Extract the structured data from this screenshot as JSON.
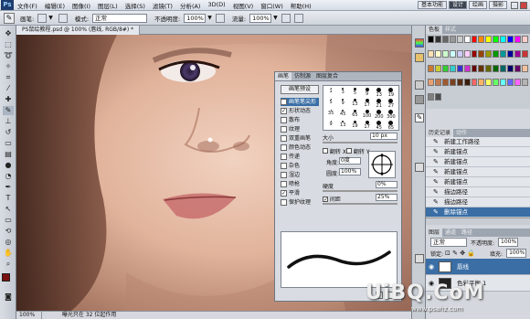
{
  "menubar": {
    "logo": "Ps",
    "items": [
      "文件(F)",
      "编辑(E)",
      "图像(I)",
      "图层(L)",
      "选择(S)",
      "滤镜(T)",
      "分析(A)",
      "3D(D)",
      "视图(V)",
      "窗口(W)",
      "帮助(H)"
    ],
    "workspace_buttons": [
      "基本功能",
      "设计",
      "绘画",
      "摄影"
    ],
    "active_workspace": "设计"
  },
  "options": {
    "mode_label": "模式:",
    "mode_value": "正常",
    "opacity_label": "不透明度:",
    "opacity_value": "100%",
    "flow_label": "流量:",
    "flow_value": "100%"
  },
  "document": {
    "tab_title": "PS鼠绘教程.psd @ 100% (唇线, RGB/8#) *",
    "zoom": "100%",
    "status": "曝光只在 32 位起作用"
  },
  "brush_panel": {
    "tabs": [
      "画笔",
      "仿制源",
      "图层复合"
    ],
    "active_tab": "画笔",
    "preset_button": "画笔预设",
    "options": [
      {
        "label": "画笔笔尖形状",
        "checked": false,
        "selected": true
      },
      {
        "label": "形状动态",
        "checked": true,
        "selected": false
      },
      {
        "label": "散布",
        "checked": false,
        "selected": false
      },
      {
        "label": "纹理",
        "checked": false,
        "selected": false
      },
      {
        "label": "双重画笔",
        "checked": false,
        "selected": false
      },
      {
        "label": "颜色动态",
        "checked": false,
        "selected": false
      },
      {
        "label": "传递",
        "checked": false,
        "selected": false
      },
      {
        "label": "杂色",
        "checked": false,
        "selected": false
      },
      {
        "label": "湿边",
        "checked": false,
        "selected": false
      },
      {
        "label": "喷枪",
        "checked": false,
        "selected": false
      },
      {
        "label": "平滑",
        "checked": true,
        "selected": false
      },
      {
        "label": "保护纹理",
        "checked": false,
        "selected": false
      }
    ],
    "tips": [
      "1",
      "3",
      "5",
      "9",
      "13",
      "19",
      "5",
      "9",
      "13",
      "17",
      "21",
      "27",
      "35",
      "45",
      "65",
      "100",
      "200",
      "300",
      "9",
      "13",
      "19",
      "17",
      "45",
      "65"
    ],
    "size_label": "大小",
    "size_value": "10 px",
    "flipx_label": "翻转 X",
    "flipy_label": "翻转 Y",
    "angle_label": "角度:",
    "angle_value": "0度",
    "roundness_label": "圆度:",
    "roundness_value": "100%",
    "hardness_label": "硬度",
    "hardness_value": "0%",
    "spacing_label": "间距",
    "spacing_value": "25%"
  },
  "swatches": {
    "tabs": [
      "色板",
      "样式"
    ],
    "colors": [
      "#000000",
      "#333333",
      "#666666",
      "#999999",
      "#cccccc",
      "#ffffff",
      "#ff0000",
      "#ff8800",
      "#ffff00",
      "#00ff00",
      "#00ffff",
      "#0000ff",
      "#ff00ff",
      "#ffcccc",
      "#ffe0b3",
      "#ffffcc",
      "#ccffcc",
      "#ccffff",
      "#ccccff",
      "#ffccff",
      "#990000",
      "#994400",
      "#999900",
      "#009900",
      "#009999",
      "#000099",
      "#990099",
      "#cc3333",
      "#cc7a33",
      "#cccc33",
      "#33cc33",
      "#33cccc",
      "#3333cc",
      "#cc33cc",
      "#660000",
      "#663300",
      "#666600",
      "#006600",
      "#006666",
      "#000066",
      "#660066",
      "#f5c2a0",
      "#e8a070",
      "#c07a50",
      "#a05a30",
      "#7a4020",
      "#5a2e16",
      "#3a1c0c",
      "#ff6666",
      "#ffb366",
      "#ffff66",
      "#66ff66",
      "#66ffff",
      "#6666ff",
      "#ff66ff",
      "#b3b3b3",
      "#808080",
      "#4d4d4d"
    ]
  },
  "history": {
    "tabs": [
      "历史记录",
      "动作"
    ],
    "rows": [
      {
        "label": "新建工作路径",
        "selected": false
      },
      {
        "label": "新建锚点",
        "selected": false
      },
      {
        "label": "新建锚点",
        "selected": false
      },
      {
        "label": "新建锚点",
        "selected": false
      },
      {
        "label": "新建锚点",
        "selected": false
      },
      {
        "label": "描边路径",
        "selected": false
      },
      {
        "label": "描边路径",
        "selected": false
      },
      {
        "label": "删除锚点",
        "selected": true
      }
    ]
  },
  "layers": {
    "tabs": [
      "图层",
      "通道",
      "路径"
    ],
    "blend_mode": "正常",
    "opacity_label": "不透明度:",
    "opacity_value": "100%",
    "lock_label": "锁定:",
    "fill_label": "填充:",
    "fill_value": "100%",
    "rows": [
      {
        "name": "唇线",
        "selected": true
      },
      {
        "name": "色彩平衡 1",
        "selected": false
      }
    ]
  },
  "watermark": {
    "main": "UiBQ.CoM",
    "sub": "www.psahz.com"
  },
  "colors": {
    "accent": "#3a6ea5",
    "foreground": "#7a1010",
    "background": "#ffffff"
  }
}
